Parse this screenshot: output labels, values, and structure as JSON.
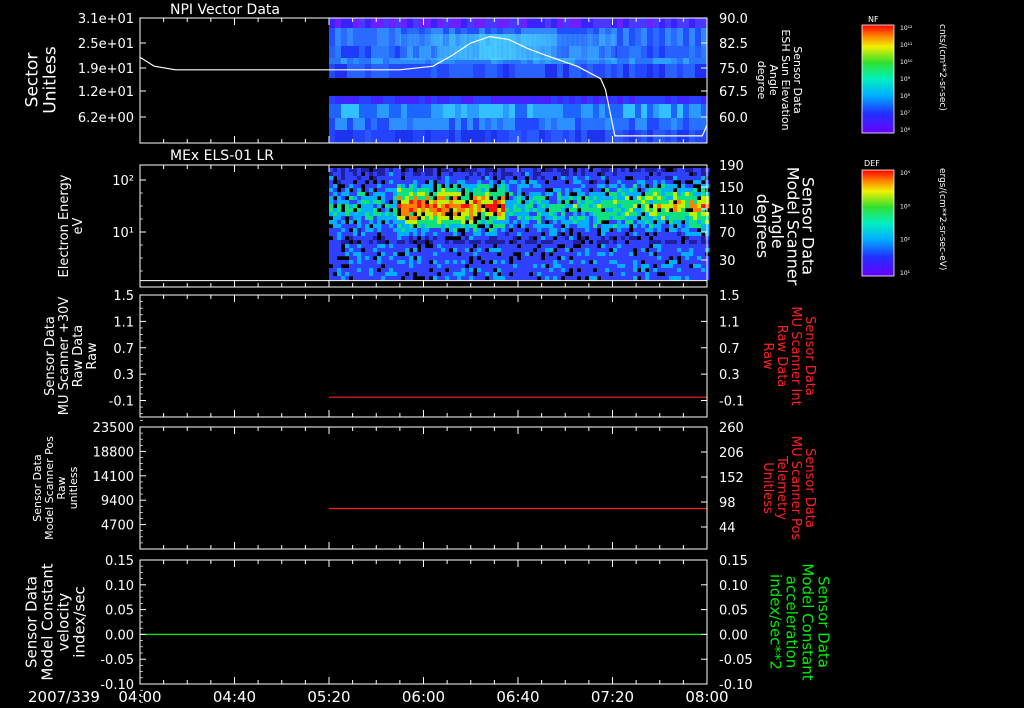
{
  "date_label": "2007/339",
  "time_ticks": [
    "04:00",
    "04:40",
    "05:20",
    "06:00",
    "06:40",
    "07:20",
    "08:00"
  ],
  "colors": {
    "background": "#000000",
    "axis": "#ffffff",
    "red_trace": "#ff2020",
    "green_trace": "#00ee00"
  },
  "chart_data": [
    {
      "type": "heatmap",
      "title": "NPI Vector Data",
      "ylabel_left": [
        "Sector",
        "Unitless"
      ],
      "yticks_left": [
        "3.1e+01",
        "2.5e+01",
        "1.9e+01",
        "1.2e+01",
        "6.2e+00"
      ],
      "ylabel_right": [
        "Sensor Data",
        "ESH Sun Elevation",
        "Angle",
        "degree"
      ],
      "yticks_right": [
        "90.0",
        "82.5",
        "75.0",
        "67.5",
        "60.0"
      ],
      "ylim_right": [
        55,
        90
      ],
      "data_start": "05:20",
      "overlay_line": {
        "name": "ESH Sun Elevation",
        "x": [
          "04:00",
          "04:06",
          "04:15",
          "04:40",
          "05:20",
          "05:50",
          "06:04",
          "06:12",
          "06:20",
          "06:28",
          "06:36",
          "06:44",
          "06:52",
          "07:05",
          "07:15",
          "07:17",
          "07:21",
          "07:40",
          "07:58",
          "08:00"
        ],
        "y": [
          79,
          76.5,
          75.5,
          75.5,
          75.5,
          75.5,
          76.5,
          79.5,
          83,
          84.8,
          84,
          81.5,
          79.5,
          76.5,
          73,
          70,
          57,
          57,
          57,
          60
        ]
      },
      "colorbar": {
        "label": "NF",
        "unit": "cnts/(cm**2-sr-sec)",
        "ticks": [
          "10¹²",
          "10¹¹",
          "10¹⁰",
          "10⁹",
          "10⁸",
          "10⁷",
          "10⁶"
        ]
      }
    },
    {
      "type": "heatmap",
      "title": "MEx ELS-01 LR",
      "ylabel_left": [
        "Electron Energy",
        "eV"
      ],
      "yticks_left": [
        "10²",
        "10¹"
      ],
      "ylabel_right": [
        "Sensor Data",
        "Model Scanner",
        "Angle",
        "degrees"
      ],
      "yticks_right": [
        "190",
        "150",
        "110",
        "70",
        "30"
      ],
      "ylim_right": [
        0,
        190
      ],
      "data_start": "05:20",
      "overlay_line": {
        "name": "Model Scanner Angle",
        "x": [
          "04:00",
          "08:00"
        ],
        "y": [
          10,
          10
        ]
      },
      "colorbar": {
        "label": "DEF",
        "unit": "ergs/(cm**2-sr-sec-eV)",
        "ticks": [
          "10⁴",
          "10³",
          "10²",
          "10¹"
        ]
      }
    },
    {
      "type": "line",
      "ylabel_left": [
        "Sensor Data",
        "MU Scanner +30V",
        "Raw Data",
        "Raw"
      ],
      "yticks_left": [
        "1.5",
        "1.1",
        "0.7",
        "0.3",
        "-0.1"
      ],
      "ylabel_right": [
        "Sensor Data",
        "MU Scanner Int",
        "Raw Data",
        "Raw"
      ],
      "yticks_right": [
        "1.5",
        "1.1",
        "0.7",
        "0.3",
        "-0.1"
      ],
      "ylim": [
        -0.35,
        1.5
      ],
      "series": [
        {
          "x": [
            "05:20",
            "08:00"
          ],
          "y": [
            -0.05,
            -0.05
          ],
          "color": "#ff2020"
        }
      ]
    },
    {
      "type": "line",
      "ylabel_left": [
        "Sensor Data",
        "Model Scanner Pos",
        "Raw",
        "unitless"
      ],
      "yticks_left": [
        "23500",
        "18800",
        "14100",
        "9400",
        "4700"
      ],
      "ylabel_right": [
        "Sensor Data",
        "MU Scanner Pos",
        "Telemetry",
        "Unitless"
      ],
      "yticks_right": [
        "260",
        "206",
        "152",
        "98",
        "44"
      ],
      "ylim": [
        0,
        23500
      ],
      "series": [
        {
          "x": [
            "05:20",
            "08:00"
          ],
          "y": [
            7800,
            7800
          ],
          "color": "#ff2020"
        }
      ]
    },
    {
      "type": "line",
      "ylabel_left": [
        "Sensor Data",
        "Model Constant",
        "velocity",
        "index/sec"
      ],
      "yticks_left": [
        "0.15",
        "0.10",
        "0.05",
        "0.00",
        "-0.05",
        "-0.10"
      ],
      "ylabel_right": [
        "Sensor Data",
        "Model Constant",
        "acceleration",
        "index/sec**2"
      ],
      "yticks_right": [
        "0.15",
        "0.10",
        "0.05",
        "0.00",
        "-0.05",
        "-0.10"
      ],
      "ylim": [
        -0.1,
        0.15
      ],
      "series": [
        {
          "x": [
            "04:00",
            "08:00"
          ],
          "y": [
            0,
            0
          ],
          "color": "#00ee00"
        }
      ]
    }
  ]
}
